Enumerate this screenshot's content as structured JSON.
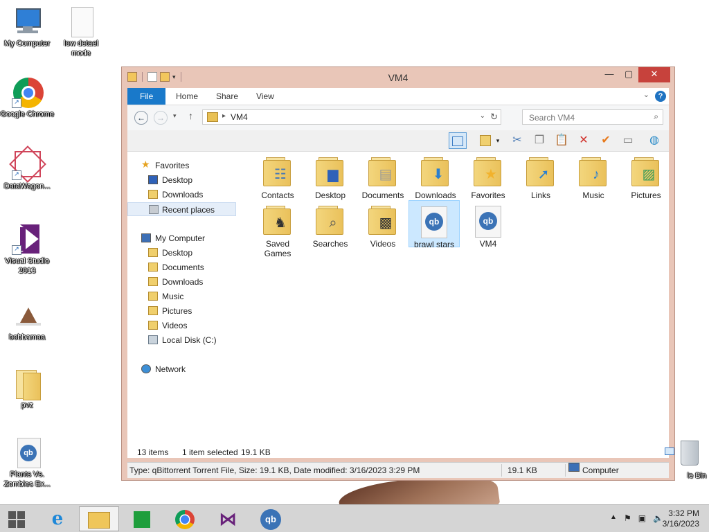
{
  "desktop": {
    "icons": [
      {
        "label": "My Computer"
      },
      {
        "label": "low detael mode"
      },
      {
        "label": "Google Chrome"
      },
      {
        "label": "DataWagon..."
      },
      {
        "label": "Visual Studio 2013"
      },
      {
        "label": "bobbamaa"
      },
      {
        "label": "pvz"
      },
      {
        "label": "Plants Vs. Zombies Ex..."
      },
      {
        "label": "le Bin"
      }
    ]
  },
  "window": {
    "title": "VM4",
    "ribbon_tabs": [
      "File",
      "Home",
      "Share",
      "View"
    ],
    "help_glyph": "?",
    "address": {
      "path": "VM4"
    },
    "search": {
      "placeholder": "Search VM4"
    },
    "nav": {
      "favorites": "Favorites",
      "favorites_items": [
        "Desktop",
        "Downloads",
        "Recent places"
      ],
      "computer": "My Computer",
      "computer_items": [
        "Desktop",
        "Documents",
        "Downloads",
        "Music",
        "Pictures",
        "Videos",
        "Local Disk (C:)"
      ],
      "network": "Network"
    },
    "files": [
      {
        "name": "Contacts",
        "icon": "contacts-icon"
      },
      {
        "name": "Desktop",
        "icon": "desktop-icon"
      },
      {
        "name": "Documents",
        "icon": "documents-icon"
      },
      {
        "name": "Downloads",
        "icon": "downloads-icon"
      },
      {
        "name": "Favorites",
        "icon": "favorites-icon"
      },
      {
        "name": "Links",
        "icon": "links-icon"
      },
      {
        "name": "Music",
        "icon": "music-icon"
      },
      {
        "name": "Pictures",
        "icon": "pictures-icon"
      },
      {
        "name": "Saved Games",
        "icon": "saved-games-icon"
      },
      {
        "name": "Searches",
        "icon": "searches-icon"
      },
      {
        "name": "Videos",
        "icon": "videos-icon"
      },
      {
        "name": "brawl stars",
        "icon": "qbittorrent-file-icon"
      },
      {
        "name": "VM4",
        "icon": "qbittorrent-file-icon"
      }
    ],
    "status": {
      "item_count": "13 items",
      "selected": "1 item selected",
      "selected_size": "19.1 KB"
    },
    "details": {
      "info": "Type: qBittorrent Torrent File, Size: 19.1 KB, Date modified: 3/16/2023 3:29 PM",
      "size": "19.1 KB",
      "location": "Computer"
    }
  },
  "taskbar": {
    "time": "3:32 PM",
    "date": "3/16/2023"
  },
  "colors": {
    "window_frame": "#e9c6b8",
    "file_tab": "#1979ca",
    "close_button": "#c7423c",
    "selection": "#cce8ff"
  }
}
